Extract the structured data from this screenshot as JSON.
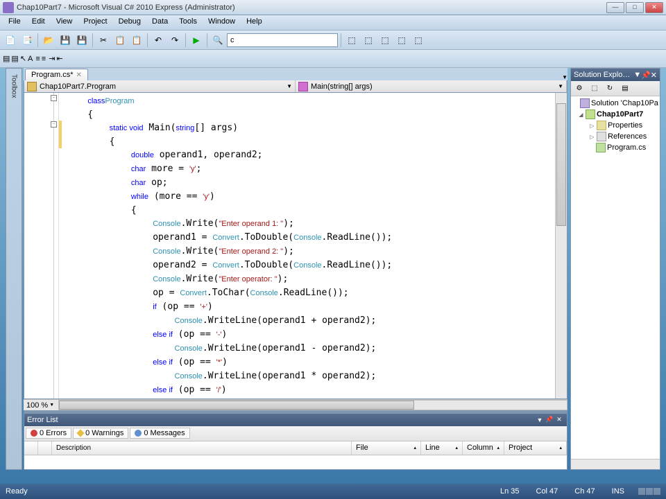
{
  "window": {
    "title": "Chap10Part7 - Microsoft Visual C# 2010 Express (Administrator)"
  },
  "menu": {
    "items": [
      "File",
      "Edit",
      "View",
      "Project",
      "Debug",
      "Data",
      "Tools",
      "Window",
      "Help"
    ]
  },
  "toolbar": {
    "combo_value": "c"
  },
  "toolbox": {
    "label": "Toolbox"
  },
  "doctab": {
    "filename": "Program.cs*"
  },
  "nav": {
    "class_drop": "Chap10Part7.Program",
    "method_drop": "Main(string[] args)"
  },
  "code": {
    "zoom": "100 %",
    "lines": [
      {
        "t": "    ",
        "k": "class",
        "t2": " ",
        "ty": "Program"
      },
      {
        "t": "    {"
      },
      {
        "t": "        ",
        "k": "static void",
        "t2": " Main(",
        "k2": "string",
        "t3": "[] args)"
      },
      {
        "t": "        {"
      },
      {
        "t": "            ",
        "k": "double",
        "t2": " operand1, operand2;"
      },
      {
        "t": "            ",
        "k": "char",
        "t2": " more = ",
        "s": "'y'",
        "t3": ";"
      },
      {
        "t": "            ",
        "k": "char",
        "t2": " op;"
      },
      {
        "t": "            ",
        "k": "while",
        "t2": " (more == ",
        "s": "'y'",
        "t3": ")"
      },
      {
        "t": "            {"
      },
      {
        "t": "                ",
        "ty": "Console",
        "t2": ".Write(",
        "s": "\"Enter operand 1: \"",
        "t3": ");"
      },
      {
        "t": "                operand1 = ",
        "ty": "Convert",
        "t2": ".ToDouble(",
        "ty2": "Console",
        "t3": ".ReadLine());"
      },
      {
        "t": "                ",
        "ty": "Console",
        "t2": ".Write(",
        "s": "\"Enter operand 2: \"",
        "t3": ");"
      },
      {
        "t": "                operand2 = ",
        "ty": "Convert",
        "t2": ".ToDouble(",
        "ty2": "Console",
        "t3": ".ReadLine());"
      },
      {
        "t": "                ",
        "ty": "Console",
        "t2": ".Write(",
        "s": "\"Enter operator: \"",
        "t3": ");"
      },
      {
        "t": "                op = ",
        "ty": "Convert",
        "t2": ".ToChar(",
        "ty2": "Console",
        "t3": ".ReadLine());"
      },
      {
        "t": "                ",
        "k": "if",
        "t2": " (op == ",
        "s": "'+'",
        "t3": ")"
      },
      {
        "t": "                    ",
        "ty": "Console",
        "t2": ".WriteLine(operand1 + operand2);"
      },
      {
        "t": "                ",
        "k": "else if",
        "t2": " (op == ",
        "s": "'-'",
        "t3": ")"
      },
      {
        "t": "                    ",
        "ty": "Console",
        "t2": ".WriteLine(operand1 - operand2);"
      },
      {
        "t": "                ",
        "k": "else if",
        "t2": " (op == ",
        "s": "'*'",
        "t3": ")"
      },
      {
        "t": "                    ",
        "ty": "Console",
        "t2": ".WriteLine(operand1 * operand2);"
      },
      {
        "t": "                ",
        "k": "else if",
        "t2": " (op == ",
        "s": "'/'",
        "t3": ")"
      }
    ]
  },
  "errorlist": {
    "title": "Error List",
    "filters": {
      "errors": "0 Errors",
      "warnings": "0 Warnings",
      "messages": "0 Messages"
    },
    "columns": [
      "",
      "",
      "Description",
      "File",
      "Line",
      "Column",
      "Project"
    ]
  },
  "solexp": {
    "title": "Solution Explo…",
    "nodes": {
      "solution": "Solution 'Chap10Pa",
      "project": "Chap10Part7",
      "properties": "Properties",
      "references": "References",
      "program": "Program.cs"
    }
  },
  "status": {
    "ready": "Ready",
    "line": "Ln 35",
    "col": "Col 47",
    "ch": "Ch 47",
    "ins": "INS"
  }
}
